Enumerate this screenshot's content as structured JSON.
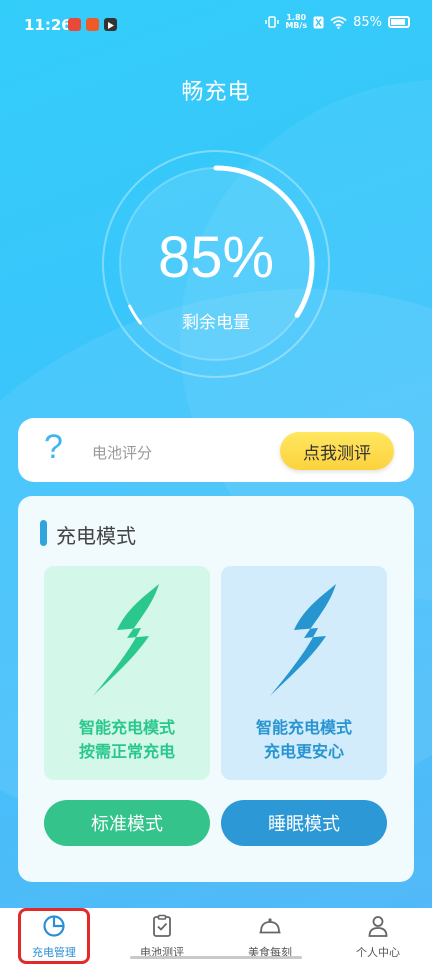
{
  "status_bar": {
    "time": "11:26",
    "speed_value": "1.80",
    "speed_unit": "MB/s",
    "battery_percent": "85%",
    "icons": [
      "notification-app-icon",
      "notification-app-icon",
      "notification-play-icon",
      "vibrate-icon",
      "wifi-icon",
      "battery-icon"
    ]
  },
  "header": {
    "title": "畅充电"
  },
  "gauge": {
    "percent": "85%",
    "label": "剩余电量",
    "level": 0.85
  },
  "rating": {
    "icon": "?",
    "label": "电池评分",
    "button": "点我测评"
  },
  "mode_section": {
    "title": "充电模式",
    "tiles": [
      {
        "line1": "智能充电模式",
        "line2": "按需正常充电",
        "icon": "lightning-bolt-icon",
        "color": "#2bc88e"
      },
      {
        "line1": "智能充电模式",
        "line2": "充电更安心",
        "icon": "lightning-bolt-icon",
        "color": "#2795d0"
      }
    ],
    "buttons": [
      "标准模式",
      "睡眠模式"
    ]
  },
  "tabs": [
    {
      "label": "充电管理",
      "icon": "pie-chart-icon",
      "active": true
    },
    {
      "label": "电池测评",
      "icon": "clipboard-check-icon",
      "active": false
    },
    {
      "label": "美食每刻",
      "icon": "food-cover-icon",
      "active": false
    },
    {
      "label": "个人中心",
      "icon": "user-icon",
      "active": false
    }
  ],
  "colors": {
    "accent": "#2a90d6",
    "highlight_border": "#e32a2a",
    "green": "#33c38b",
    "blue": "#2c98d6",
    "yellow": "#fcd23e"
  }
}
